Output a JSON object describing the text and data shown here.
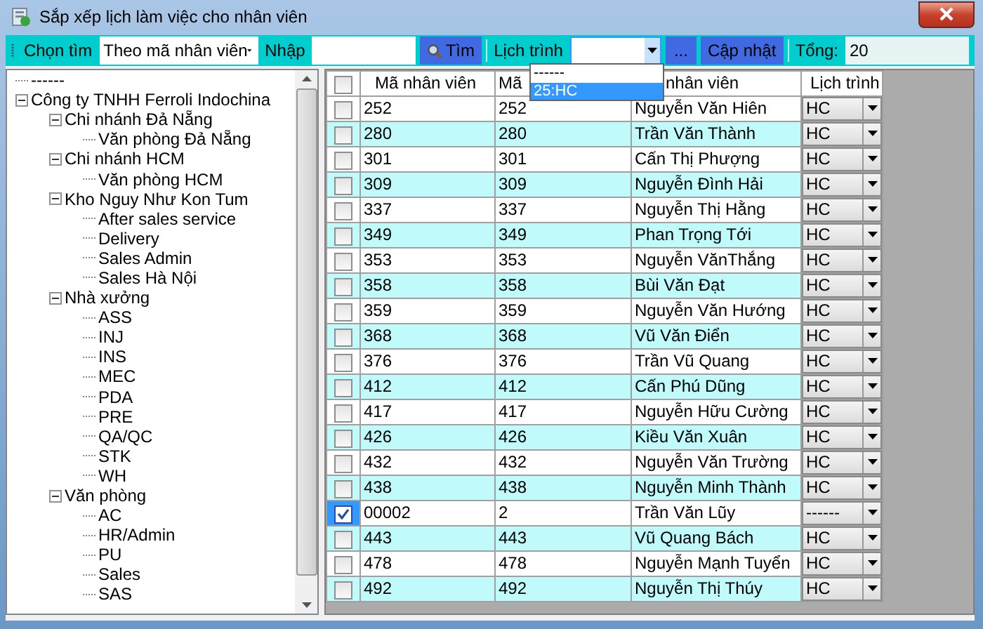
{
  "window": {
    "title": "Sắp xếp lịch làm việc cho nhân viên"
  },
  "toolbar": {
    "search_by_label": "Chọn tìm",
    "search_by": "Theo mã nhân viên",
    "input_label": "Nhập",
    "search_button": "Tìm",
    "schedule_label": "Lịch trình",
    "more_button": "...",
    "update_button": "Cập nhật",
    "total_label": "Tổng:",
    "total_value": "20"
  },
  "schedule_dropdown": {
    "options": [
      {
        "label": "------",
        "selected": false
      },
      {
        "label": "25:HC",
        "selected": true
      }
    ]
  },
  "tree": [
    {
      "label": "------"
    },
    {
      "label": "Công ty TNHH Ferroli Indochina",
      "expanded": true,
      "children": [
        {
          "label": "Chi nhánh Đả Nẵng",
          "expanded": true,
          "children": [
            {
              "label": "Văn phòng Đả Nẵng"
            }
          ]
        },
        {
          "label": "Chi nhánh HCM",
          "expanded": true,
          "children": [
            {
              "label": "Văn phòng HCM"
            }
          ]
        },
        {
          "label": "Kho Nguy Như Kon Tum",
          "expanded": true,
          "children": [
            {
              "label": "After sales service"
            },
            {
              "label": "Delivery"
            },
            {
              "label": "Sales Admin"
            },
            {
              "label": "Sales Hà Nội"
            }
          ]
        },
        {
          "label": "Nhà xưởng",
          "expanded": true,
          "children": [
            {
              "label": "ASS"
            },
            {
              "label": "INJ"
            },
            {
              "label": "INS"
            },
            {
              "label": "MEC"
            },
            {
              "label": "PDA"
            },
            {
              "label": "PRE"
            },
            {
              "label": "QA/QC"
            },
            {
              "label": "STK"
            },
            {
              "label": "WH"
            }
          ]
        },
        {
          "label": "Văn phòng",
          "expanded": true,
          "children": [
            {
              "label": "AC"
            },
            {
              "label": "HR/Admin"
            },
            {
              "label": "PU"
            },
            {
              "label": "Sales"
            },
            {
              "label": "SAS"
            }
          ]
        }
      ]
    }
  ],
  "table": {
    "header_checked": false,
    "columns": [
      "Mã nhân viên",
      "Mã",
      "nhân viên",
      "Lịch trình"
    ],
    "rows": [
      {
        "checked": false,
        "code": "252",
        "id": "252",
        "name": "Nguyễn Văn Hiên",
        "schedule": "HC"
      },
      {
        "checked": false,
        "code": "280",
        "id": "280",
        "name": "Trần Văn Thành",
        "schedule": "HC"
      },
      {
        "checked": false,
        "code": "301",
        "id": "301",
        "name": "Cấn Thị Phượng",
        "schedule": "HC"
      },
      {
        "checked": false,
        "code": "309",
        "id": "309",
        "name": "Nguyễn Đình Hải",
        "schedule": "HC"
      },
      {
        "checked": false,
        "code": "337",
        "id": "337",
        "name": "Nguyễn Thị Hằng",
        "schedule": "HC"
      },
      {
        "checked": false,
        "code": "349",
        "id": "349",
        "name": "Phan Trọng Tới",
        "schedule": "HC"
      },
      {
        "checked": false,
        "code": "353",
        "id": "353",
        "name": "Nguyễn VănThắng",
        "schedule": "HC"
      },
      {
        "checked": false,
        "code": "358",
        "id": "358",
        "name": "Bùi Văn Đạt",
        "schedule": "HC"
      },
      {
        "checked": false,
        "code": "359",
        "id": "359",
        "name": "Nguyễn Văn Hướng",
        "schedule": "HC"
      },
      {
        "checked": false,
        "code": "368",
        "id": "368",
        "name": "Vũ Văn Điển",
        "schedule": "HC"
      },
      {
        "checked": false,
        "code": "376",
        "id": "376",
        "name": "Trần Vũ Quang",
        "schedule": "HC"
      },
      {
        "checked": false,
        "code": "412",
        "id": "412",
        "name": "Cấn Phú Dũng",
        "schedule": "HC"
      },
      {
        "checked": false,
        "code": "417",
        "id": "417",
        "name": "Nguyễn Hữu Cường",
        "schedule": "HC"
      },
      {
        "checked": false,
        "code": "426",
        "id": "426",
        "name": "Kiều Văn Xuân",
        "schedule": "HC"
      },
      {
        "checked": false,
        "code": "432",
        "id": "432",
        "name": "Nguyễn Văn Trường",
        "schedule": "HC"
      },
      {
        "checked": false,
        "code": "438",
        "id": "438",
        "name": "Nguyễn Minh Thành",
        "schedule": "HC"
      },
      {
        "checked": true,
        "code": "00002",
        "id": "2",
        "name": "Trần Văn Lũy",
        "schedule": "------"
      },
      {
        "checked": false,
        "code": "443",
        "id": "443",
        "name": "Vũ Quang Bách",
        "schedule": "HC"
      },
      {
        "checked": false,
        "code": "478",
        "id": "478",
        "name": "Nguyễn Mạnh Tuyển",
        "schedule": "HC"
      },
      {
        "checked": false,
        "code": "492",
        "id": "492",
        "name": "Nguyễn Thị Thúy",
        "schedule": "HC"
      }
    ]
  }
}
